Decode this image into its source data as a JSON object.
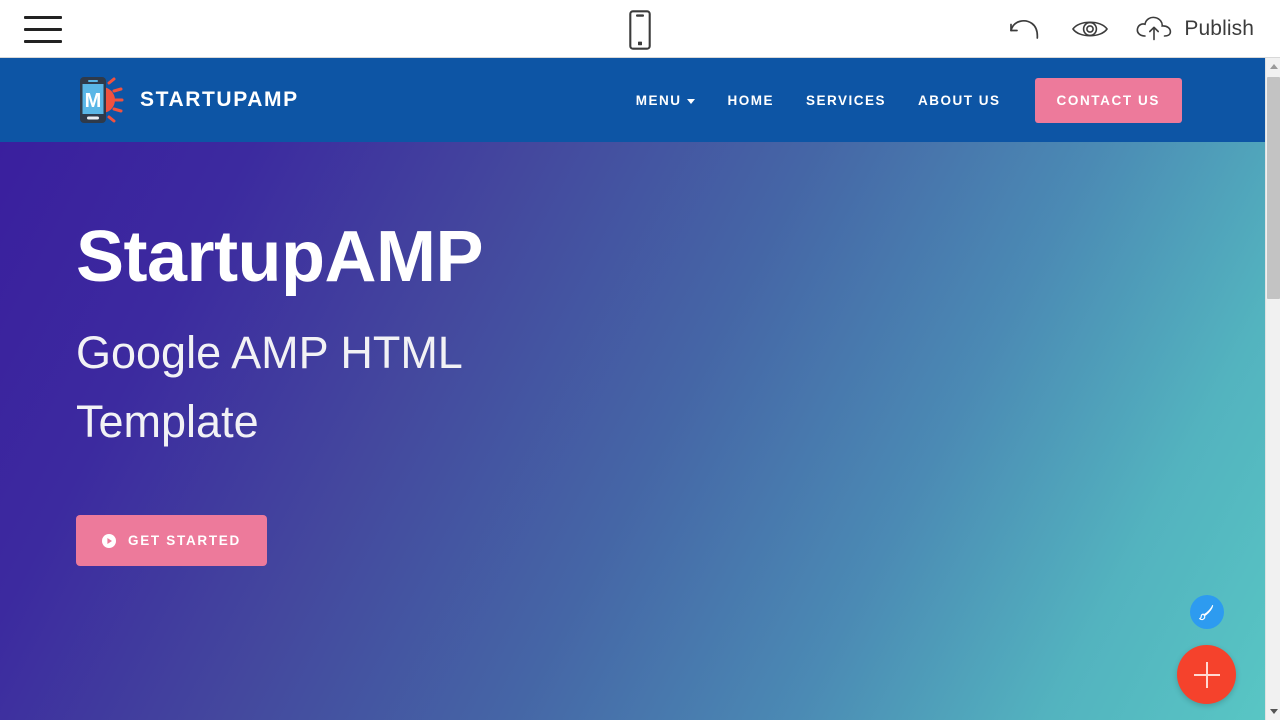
{
  "editor": {
    "menu_icon": "hamburger-menu-icon",
    "device_preview_icon": "mobile-device-icon",
    "undo_icon": "undo-arrow-icon",
    "preview_icon": "eye-preview-icon",
    "publish_icon": "cloud-upload-icon",
    "publish_label": "Publish"
  },
  "site": {
    "navbar": {
      "background_color": "#0d55a5",
      "brand_name": "STARTUPAMP",
      "brand_logo_icon": "mobile-phone-sunburst-logo",
      "brand_logo_letter": "M",
      "links": [
        {
          "label": "MENU",
          "has_caret": true
        },
        {
          "label": "HOME",
          "has_caret": false
        },
        {
          "label": "SERVICES",
          "has_caret": false
        },
        {
          "label": "ABOUT US",
          "has_caret": false
        }
      ],
      "cta_label": "CONTACT US",
      "cta_color": "#ed7a9b"
    },
    "hero": {
      "title": "StartupAMP",
      "subtitle": "Google AMP HTML Template",
      "button_label": "GET STARTED",
      "button_icon": "play-circle-icon",
      "button_color": "#ed7a9b",
      "gradient_start": "#3a1f9e",
      "gradient_end": "#58c6c4"
    }
  },
  "fabs": {
    "style_button_icon": "paintbrush-icon",
    "style_button_color": "#2d9bf0",
    "add_button_icon": "plus-icon",
    "add_button_color": "#f5422c"
  },
  "scrollbar": {
    "up_arrow_icon": "triangle-up-icon",
    "down_arrow_icon": "triangle-down-icon"
  }
}
